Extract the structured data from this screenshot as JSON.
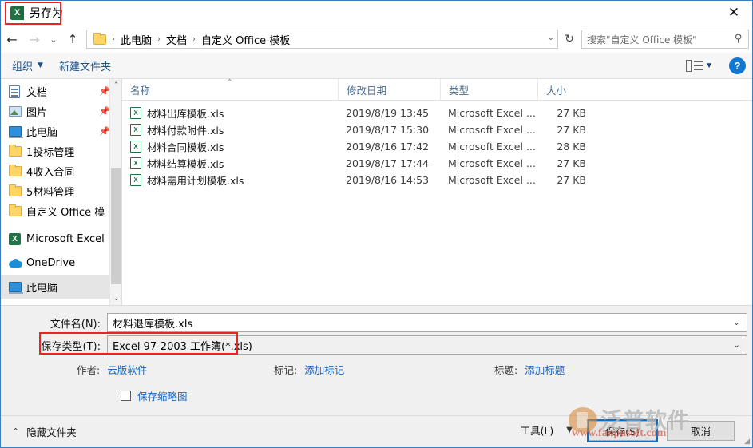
{
  "window": {
    "title": "另存为",
    "app_icon": "excel-icon",
    "close_label": "✕"
  },
  "navbar": {
    "back_icon": "←",
    "forward_icon": "→",
    "recent_icon": "⌄",
    "up_icon": "↑",
    "refresh_icon": "↻",
    "folder_icon": "folder-icon",
    "breadcrumb": [
      "此电脑",
      "文档",
      "自定义 Office 模板"
    ],
    "separator": "›",
    "dropdown_icon": "⌄"
  },
  "search": {
    "placeholder": "搜索\"自定义 Office 模板\"",
    "icon": "search-icon"
  },
  "toolbar": {
    "organize_label": "组织",
    "organize_caret": "▼",
    "new_folder_label": "新建文件夹",
    "view_caret": "▼",
    "help_label": "?"
  },
  "sidebar": {
    "items": [
      {
        "label": "文档",
        "icon": "document-icon",
        "pinned": true,
        "selected": false
      },
      {
        "label": "图片",
        "icon": "picture-icon",
        "pinned": true,
        "selected": false
      },
      {
        "label": "此电脑",
        "icon": "this-pc-icon",
        "pinned": true,
        "selected": false
      },
      {
        "label": "1投标管理",
        "icon": "folder-icon",
        "pinned": false,
        "selected": false
      },
      {
        "label": "4收入合同",
        "icon": "folder-icon",
        "pinned": false,
        "selected": false
      },
      {
        "label": "5材料管理",
        "icon": "folder-icon",
        "pinned": false,
        "selected": false
      },
      {
        "label": "自定义 Office 模",
        "icon": "folder-icon",
        "pinned": false,
        "selected": false
      },
      {
        "label": "Microsoft Excel",
        "icon": "excel-icon",
        "pinned": false,
        "selected": false
      },
      {
        "label": "OneDrive",
        "icon": "onedrive-icon",
        "pinned": false,
        "selected": false
      },
      {
        "label": "此电脑",
        "icon": "this-pc-icon",
        "pinned": false,
        "selected": true
      }
    ],
    "scroll_up_icon": "⌃",
    "scroll_down_icon": "⌄"
  },
  "filelist": {
    "columns": [
      "名称",
      "修改日期",
      "类型",
      "大小"
    ],
    "sort_indicator": "⌃",
    "rows": [
      {
        "name": "材料出库模板.xls",
        "date": "2019/8/19 13:45",
        "type": "Microsoft Excel ...",
        "size": "27 KB",
        "icon": "excel-file-icon"
      },
      {
        "name": "材料付款附件.xls",
        "date": "2019/8/17 15:30",
        "type": "Microsoft Excel ...",
        "size": "27 KB",
        "icon": "excel-file-icon"
      },
      {
        "name": "材料合同模板.xls",
        "date": "2019/8/16 17:42",
        "type": "Microsoft Excel ...",
        "size": "28 KB",
        "icon": "excel-file-icon"
      },
      {
        "name": "材料结算模板.xls",
        "date": "2019/8/17 17:44",
        "type": "Microsoft Excel ...",
        "size": "27 KB",
        "icon": "excel-file-icon"
      },
      {
        "name": "材料需用计划模板.xls",
        "date": "2019/8/16 14:53",
        "type": "Microsoft Excel ...",
        "size": "27 KB",
        "icon": "excel-file-icon"
      }
    ]
  },
  "form": {
    "filename_label": "文件名(N):",
    "filename_value": "材料退库模板.xls",
    "filetype_label": "保存类型(T):",
    "filetype_value": "Excel 97-2003 工作簿(*.xls)",
    "combo_caret": "⌄",
    "author_label": "作者:",
    "author_value": "云版软件",
    "tag_label": "标记:",
    "tag_value": "添加标记",
    "title_label": "标题:",
    "title_value": "添加标题",
    "thumbnail_label": "保存缩略图"
  },
  "footer": {
    "hide_folders_label": "隐藏文件夹",
    "hide_folders_caret": "⌃",
    "tools_label": "工具(L)",
    "tools_caret": "▼",
    "save_label": "保存(S)",
    "cancel_label": "取消"
  },
  "watermark": {
    "brand_cn": "泛普软件",
    "url": "www.fanpusoft.com"
  },
  "colors": {
    "accent_blue": "#0a70c8",
    "link_blue": "#1a68c4",
    "excel_green": "#217346",
    "highlight_red": "#ee2222",
    "folder_yellow": "#ffd565"
  }
}
